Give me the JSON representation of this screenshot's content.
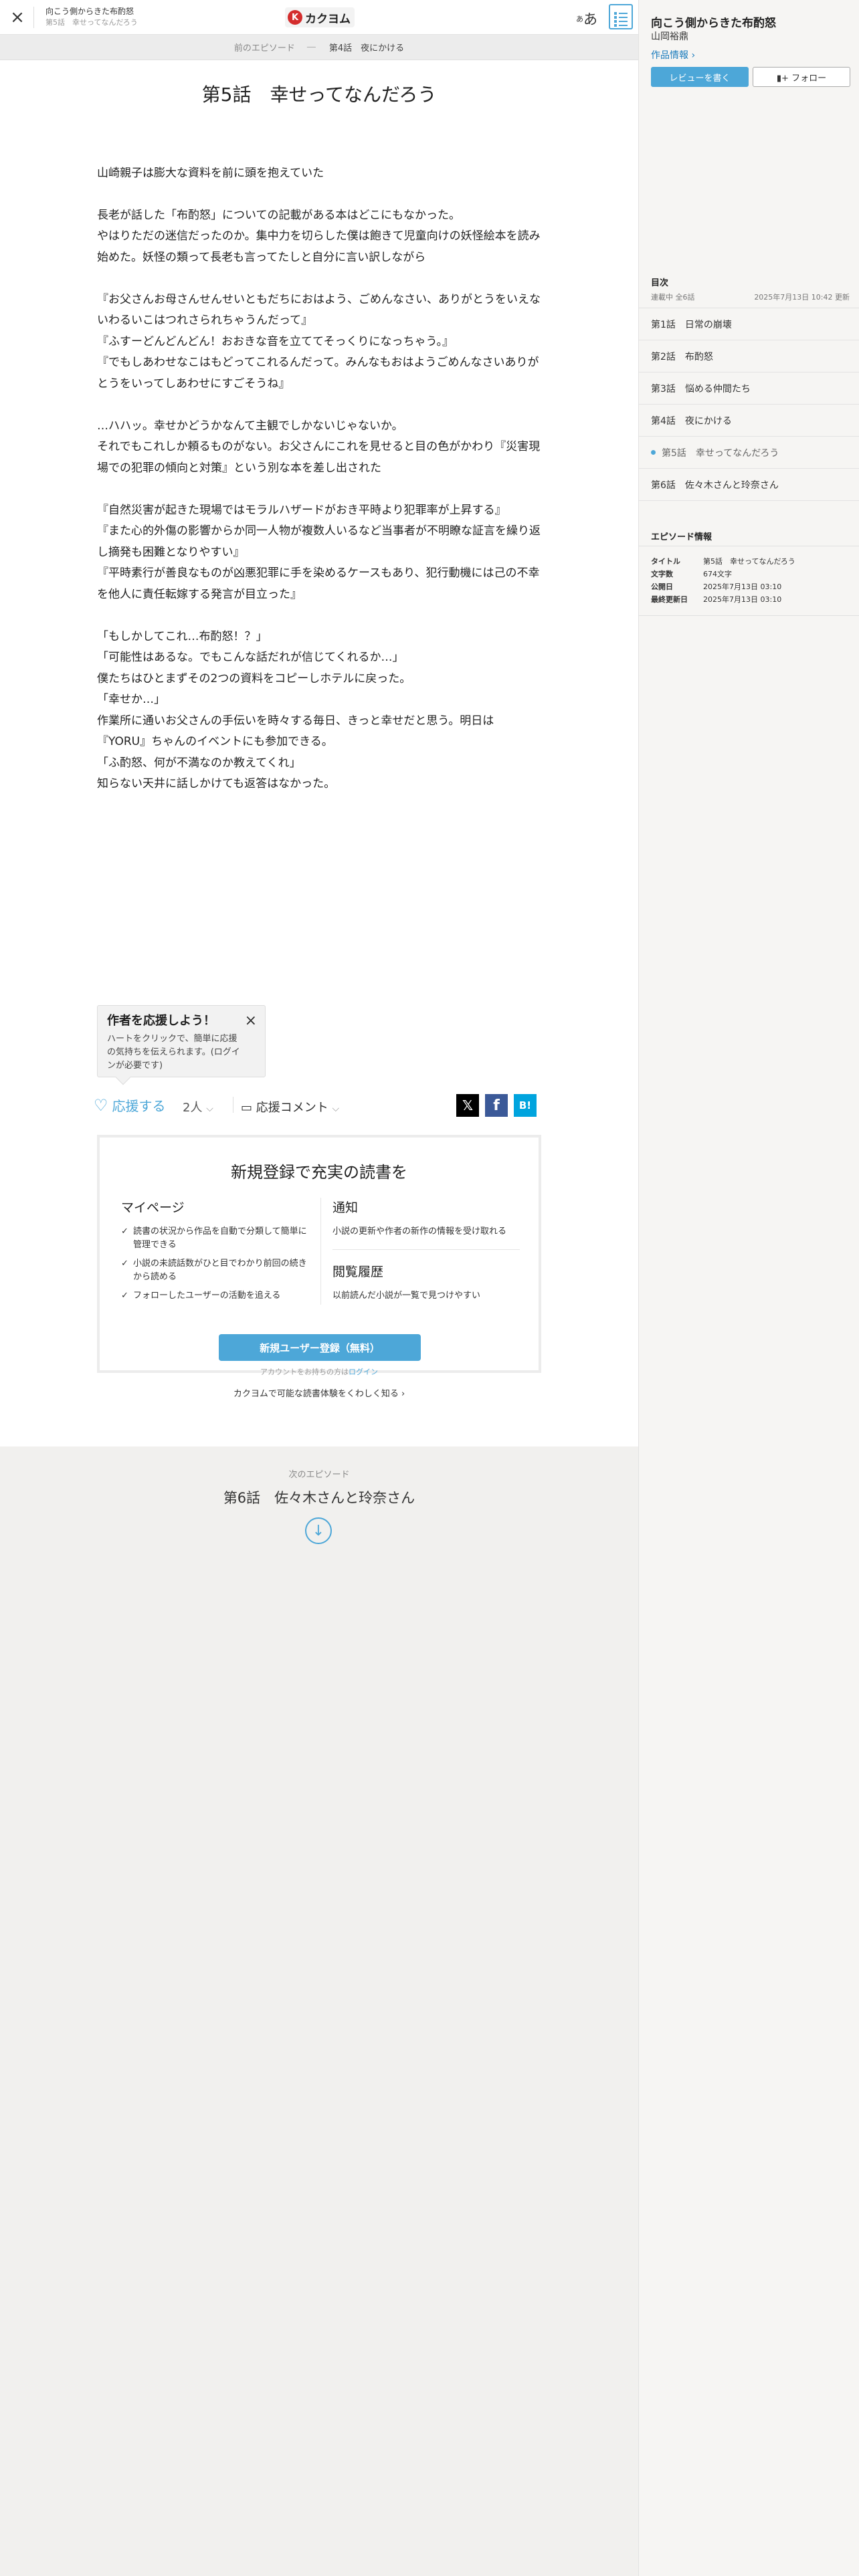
{
  "header": {
    "close_icon": "×",
    "work_title": "向こう側からきた布酌怒",
    "episode_sub": "第5話　幸せってなんだろう",
    "logo_mark": "K",
    "logo_text": "カクヨム",
    "font_small": "あ",
    "font_large": "あ"
  },
  "prev_nav": {
    "label": "前のエピソード",
    "dots": "―",
    "episode": "第4話　夜にかける"
  },
  "episode": {
    "title": "第5話　幸せってなんだろう",
    "paragraphs": [
      "",
      "山崎親子は膨大な資料を前に頭を抱えていた",
      "",
      "長老が話した「布酌怒」についての記載がある本はどこにもなかった。",
      "やはりただの迷信だったのか。集中力を切らした僕は飽きて児童向けの妖怪絵本を読み始めた。妖怪の類って長老も言ってたしと自分に言い訳しながら",
      "",
      "『お父さんお母さんせんせいともだちにおはよう、ごめんなさい、ありがとうをいえないわるいこはつれさられちゃうんだって』",
      "『ふすーどんどんどん！おおきな音を立ててそっくりになっちゃう。』",
      "『でもしあわせなこはもどってこれるんだって。みんなもおはようごめんなさいありがとうをいってしあわせにすごそうね』",
      "",
      "…ハハッ。幸せかどうかなんて主観でしかないじゃないか。",
      "それでもこれしか頼るものがない。お父さんにこれを見せると目の色がかわり『災害現場での犯罪の傾向と対策』という別な本を差し出された",
      "",
      "『自然災害が起きた現場ではモラルハザードがおき平時より犯罪率が上昇する』",
      "『また心的外傷の影響からか同一人物が複数人いるなど当事者が不明瞭な証言を繰り返し摘発も困難となりやすい』",
      "『平時素行が善良なものが凶悪犯罪に手を染めるケースもあり、犯行動機には己の不幸を他人に責任転嫁する発言が目立った』",
      "",
      "「もしかしてこれ…布酌怒！？」",
      "「可能性はあるな。でもこんな話だれが信じてくれるか…」",
      "僕たちはひとまずその2つの資料をコピーしホテルに戻った。",
      "「幸せか…」",
      "作業所に通いお父さんの手伝いを時々する毎日、きっと幸せだと思う。明日は『YORU』ちゃんのイベントにも参加できる。",
      "「ふ酌怒、何が不満なのか教えてくれ」",
      "知らない天井に話しかけても返答はなかった。"
    ]
  },
  "cheer_popup": {
    "title": "作者を応援しよう！",
    "text": "ハートをクリックで、簡単に応援の気持ちを伝えられます。(ログインが必要です)",
    "close_icon": "×"
  },
  "cheer_bar": {
    "heart_icon": "♡",
    "cheer_label": "応援する",
    "count": "2人",
    "count_chevron": "⌵",
    "comment_icon": "▭",
    "comment_label": "応援コメント",
    "comment_chevron": "⌵",
    "x_icon": "𝕏",
    "facebook_icon": "f",
    "hatena_icon": "B!"
  },
  "register": {
    "title": "新規登録で充実の読書を",
    "mypage_title": "マイページ",
    "mypage_items": [
      "読書の状況から作品を自動で分類して簡単に管理できる",
      "小説の未読話数がひと目でわかり前回の続きから読める",
      "フォローしたユーザーの活動を追える"
    ],
    "notify_title": "通知",
    "notify_desc": "小説の更新や作者の新作の情報を受け取れる",
    "history_title": "閲覧履歴",
    "history_desc": "以前読んだ小説が一覧で見つけやすい",
    "button": "新規ユーザー登録（無料）",
    "login_text": "アカウントをお持ちの方は",
    "login_link": "ログイン",
    "more_link": "カクヨムで可能な読書体験をくわしく知る ›"
  },
  "next": {
    "label": "次のエピソード",
    "title": "第6話　佐々木さんと玲奈さん",
    "arrow_icon": "↓"
  },
  "sidebar": {
    "work_title": "向こう側からきた布酌怒",
    "author": "山岡裕鼎",
    "info_link": "作品情報 ›",
    "review_button": "レビューを書く",
    "follow_button": "▮+ フォロー",
    "toc_heading": "目次",
    "status": "連載中 全6話",
    "updated": "2025年7月13日 10:42 更新",
    "episodes": [
      {
        "label": "第1話　日常の崩壊"
      },
      {
        "label": "第2話　布酌怒"
      },
      {
        "label": "第3話　悩める仲間たち"
      },
      {
        "label": "第4話　夜にかける"
      },
      {
        "label": "第5話　幸せってなんだろう",
        "current": true
      },
      {
        "label": "第6話　佐々木さんと玲奈さん"
      }
    ],
    "episode_info_heading": "エピソード情報",
    "episode_info": [
      {
        "key": "タイトル",
        "value": "第5話　幸せってなんだろう"
      },
      {
        "key": "文字数",
        "value": "674文字"
      },
      {
        "key": "公開日",
        "value": "2025年7月13日 03:10"
      },
      {
        "key": "最終更新日",
        "value": "2025年7月13日 03:10"
      }
    ]
  },
  "colors": {
    "accent": "#4da7d8",
    "link": "#1b7cbd",
    "logo_red": "#d42d2d",
    "background": "#f1f0ee"
  }
}
